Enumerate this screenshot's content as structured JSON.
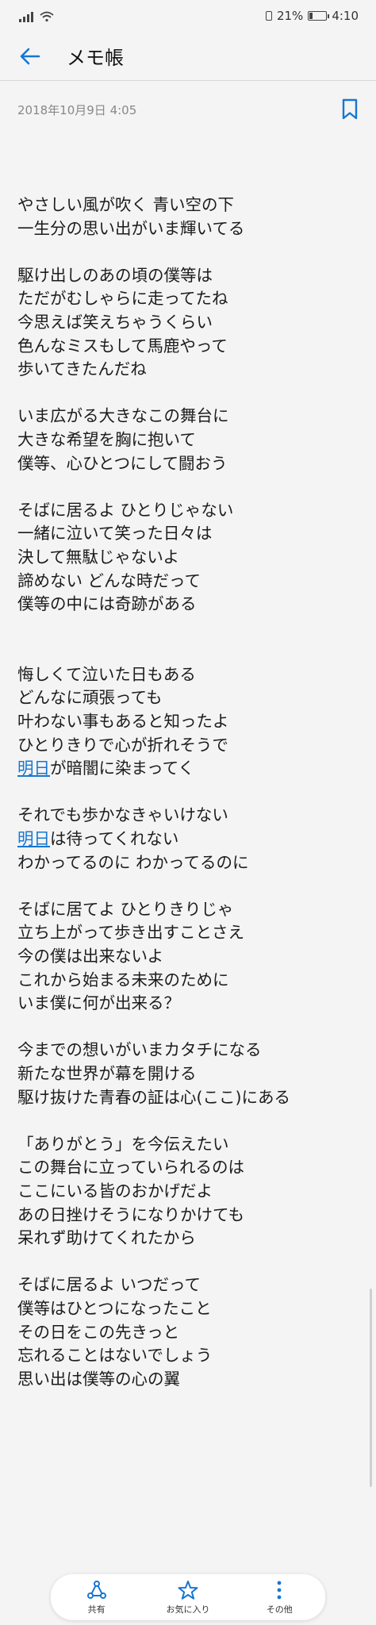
{
  "status": {
    "battery": "21%",
    "time": "4:10"
  },
  "header": {
    "title": "メモ帳"
  },
  "note": {
    "date": "2018年10月9日 4:05",
    "paragraphs": [
      [
        "やさしい風が吹く 青い空の下",
        "一生分の思い出がいま輝いてる"
      ],
      [
        "駆け出しのあの頃の僕等は",
        "ただがむしゃらに走ってたね",
        "今思えば笑えちゃうくらい",
        "色んなミスもして馬鹿やって",
        "歩いてきたんだね"
      ],
      [
        "いま広がる大きなこの舞台に",
        "大きな希望を胸に抱いて",
        "僕等、心ひとつにして闘おう"
      ],
      [
        "そばに居るよ ひとりじゃない",
        "一緒に泣いて笑った日々は",
        "決して無駄じゃないよ",
        "諦めない どんな時だって",
        "僕等の中には奇跡がある"
      ],
      [
        "悔しくて泣いた日もある",
        "どんなに頑張っても",
        "叶わない事もあると知ったよ",
        "ひとりきりで心が折れそうで",
        {
          "link": "明日",
          "text": "が暗闇に染まってく"
        }
      ],
      [
        "それでも歩かなきゃいけない",
        {
          "link": "明日",
          "text": "は待ってくれない"
        },
        "わかってるのに わかってるのに"
      ],
      [
        "そばに居てよ ひとりきりじゃ",
        "立ち上がって歩き出すことさえ",
        "今の僕は出来ないよ",
        "これから始まる未来のために",
        "いま僕に何が出来る？"
      ],
      [
        "今までの想いがいまカタチになる",
        "新たな世界が幕を開ける",
        "駆け抜けた青春の証は心(ここ)にある"
      ],
      [
        "「ありがとう」を今伝えたい",
        "この舞台に立っていられるのは",
        "ここにいる皆のおかげだよ",
        "あの日挫けそうになりかけても",
        "呆れず助けてくれたから"
      ],
      [
        "そばに居るよ いつだって",
        "僕等はひとつになったこと",
        "その日をこの先きっと",
        "忘れることはないでしょう",
        "思い出は僕等の心の翼"
      ]
    ]
  },
  "toolbar": {
    "share": "共有",
    "favorite": "お気に入り",
    "more": "その他"
  },
  "colors": {
    "accent": "#1677d2",
    "background": "#f4f4f4"
  },
  "icons": {
    "back": "back-arrow-icon",
    "bookmark": "bookmark-icon",
    "share": "share-icon",
    "favorite": "star-icon",
    "more": "more-vertical-icon",
    "signal": "signal-icon",
    "wifi": "wifi-icon",
    "battery": "battery-icon"
  },
  "levels": {
    "battery_fraction": 0.21
  }
}
